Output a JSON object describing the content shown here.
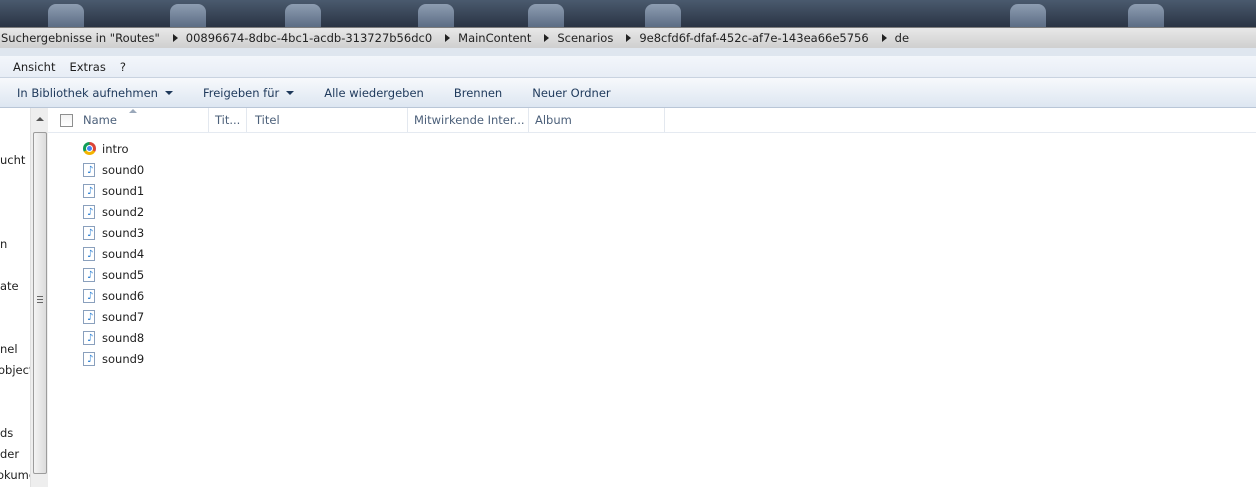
{
  "breadcrumbs": [
    "Suchergebnisse in \"Routes\"",
    "00896674-8dbc-4bc1-acdb-313727b56dc0",
    "MainContent",
    "Scenarios",
    "9e8cfd6f-dfaf-452c-af7e-143ea66e5756",
    "de"
  ],
  "menu": [
    "Ansicht",
    "Extras",
    "?"
  ],
  "commands": [
    {
      "label": "In Bibliothek aufnehmen",
      "dropdown": true
    },
    {
      "label": "Freigeben für",
      "dropdown": true
    },
    {
      "label": "Alle wiedergeben",
      "dropdown": false
    },
    {
      "label": "Brennen",
      "dropdown": false
    },
    {
      "label": "Neuer Ordner",
      "dropdown": false
    }
  ],
  "nav_items": [
    "ucht",
    "n",
    "ate",
    "nel",
    "object",
    "ds",
    "der",
    "okume"
  ],
  "columns": [
    "Name",
    "Tit...",
    "Titel",
    "Mitwirkende Inter...",
    "Album"
  ],
  "files": [
    {
      "name": "intro",
      "icon": "chrome-icon"
    },
    {
      "name": "sound0",
      "icon": "audio-file-icon"
    },
    {
      "name": "sound1",
      "icon": "audio-file-icon"
    },
    {
      "name": "sound2",
      "icon": "audio-file-icon"
    },
    {
      "name": "sound3",
      "icon": "audio-file-icon"
    },
    {
      "name": "sound4",
      "icon": "audio-file-icon"
    },
    {
      "name": "sound5",
      "icon": "audio-file-icon"
    },
    {
      "name": "sound6",
      "icon": "audio-file-icon"
    },
    {
      "name": "sound7",
      "icon": "audio-file-icon"
    },
    {
      "name": "sound8",
      "icon": "audio-file-icon"
    },
    {
      "name": "sound9",
      "icon": "audio-file-icon"
    }
  ],
  "colors": {
    "command_text": "#1e395b",
    "header_text": "#4c607a",
    "toolbar_bg": "#dde6f1"
  }
}
